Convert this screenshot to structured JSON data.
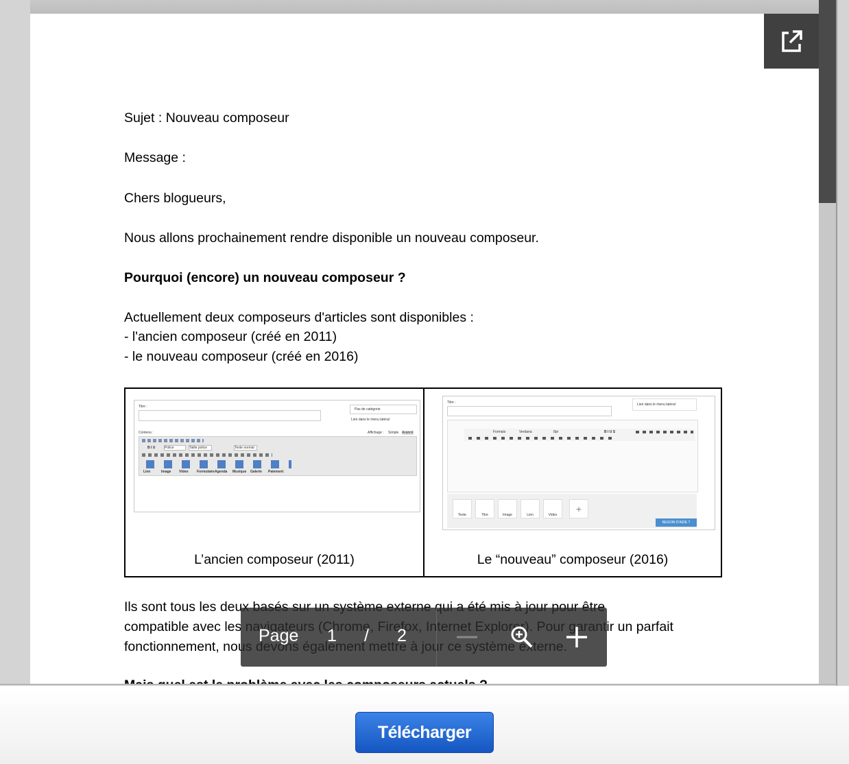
{
  "document": {
    "line_subject": "Sujet : Nouveau composeur",
    "line_message": "Message :",
    "line_greeting": "Chers blogueurs,",
    "line_intro": "Nous allons prochainement rendre disponible un nouveau composeur.",
    "heading_why": "Pourquoi (encore) un nouveau composeur ?",
    "para_current": "Actuellement deux composeurs d'articles sont disponibles :",
    "bullet_old": "- l'ancien composeur (créé en 2011)",
    "bullet_new": "- le nouveau composeur (créé en 2016)",
    "para2_line1": "Ils sont tous les deux basés sur un système externe qui a été mis à jour pour être",
    "para2_line2": "compatible avec les navigateurs (Chrome, Firefox, Internet Explorer). Pour garantir un parfait",
    "para2_line3": "fonctionnement, nous devons également mettre à jour ce système externe.",
    "cut_heading": "Mais quel est le problème avec les composeurs actuels ?"
  },
  "figure": {
    "caption_old": "L’ancien composeur (2011)",
    "caption_new": "Le “nouveau” composeur (2016)",
    "old_editor": {
      "title_label": "Titre :",
      "category_select": "Pas de catégorie",
      "side_menu_label": "Lien dans le menu latéral",
      "content_label": "Contenu :",
      "display_label": "Affichage :",
      "display_simple": "Simple",
      "display_advanced": "Avancé",
      "font_select": "Police",
      "size_select": "Taille police",
      "style_select": "Texte normal",
      "tools": [
        "Lien",
        "Image",
        "Video",
        "Formulaire",
        "Agenda",
        "Musique",
        "Galerie",
        "Paiement"
      ]
    },
    "new_editor": {
      "title_label": "Titre :",
      "side_menu_label": "Lien dans le menu latéral",
      "formats_select": "Formats",
      "font_select": "Verdana",
      "size_select": "8pt",
      "blocks": [
        "Texte",
        "Titre",
        "Image",
        "Lien",
        "Video"
      ],
      "help_button": "BESOIN D'AIDE ?"
    }
  },
  "pager": {
    "page_label": "Page",
    "current_page": "1",
    "separator": "/",
    "total_pages": "2"
  },
  "footer": {
    "download_label": "Télécharger"
  },
  "colors": {
    "download_button": "#1f66d6",
    "pager_background": "#282828",
    "scrollbar_thumb": "#4a4a4a"
  }
}
